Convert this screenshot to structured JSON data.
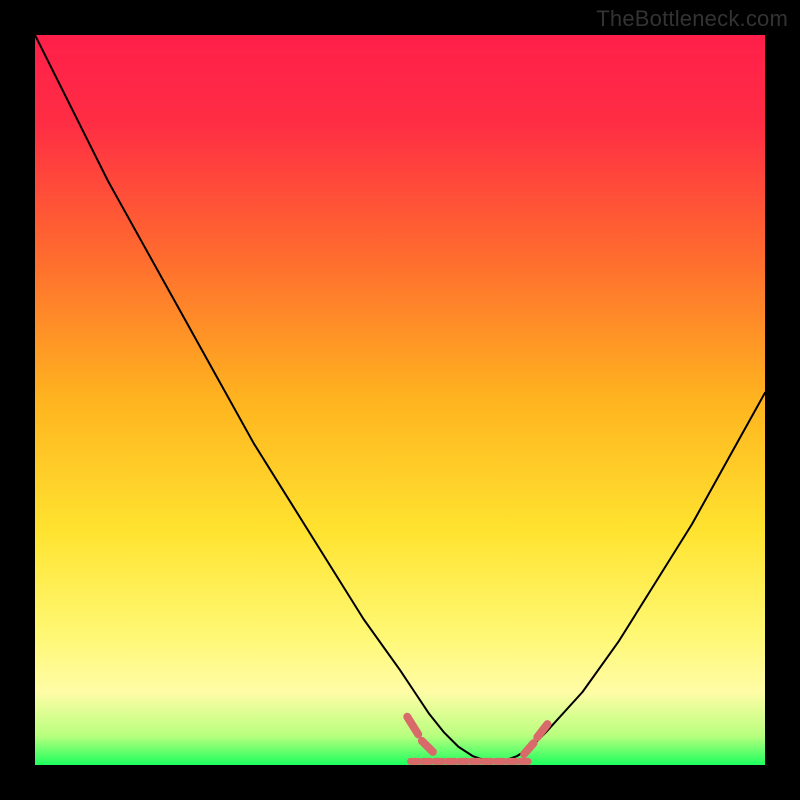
{
  "watermark": "TheBottleneck.com",
  "colors": {
    "black": "#000000",
    "red": "#ff1f4a",
    "yellow": "#ffe330",
    "pale_yellow": "#fffca6",
    "green": "#1dff5e",
    "curve": "#000000",
    "dots": "#d86a6a"
  },
  "chart_data": {
    "type": "line",
    "title": "",
    "xlabel": "",
    "ylabel": "",
    "xlim": [
      0,
      100
    ],
    "ylim": [
      0,
      100
    ],
    "x": [
      0,
      5,
      10,
      15,
      20,
      25,
      30,
      35,
      40,
      45,
      50,
      52,
      54,
      56,
      58,
      60,
      62,
      64,
      66,
      68,
      70,
      75,
      80,
      85,
      90,
      95,
      100
    ],
    "values": [
      100,
      90,
      80,
      71,
      62,
      53,
      44,
      36,
      28,
      20,
      13,
      10,
      7,
      4.5,
      2.5,
      1.2,
      0.5,
      0.5,
      1.2,
      2.5,
      4.5,
      10,
      17,
      25,
      33,
      42,
      51
    ],
    "flat_region": {
      "x_start": 52,
      "x_end": 67,
      "y": 0.5,
      "num_dots_bottom": 10
    },
    "gradient_stops": [
      {
        "offset": 0.0,
        "color": "#ff1f4a"
      },
      {
        "offset": 0.12,
        "color": "#ff2d44"
      },
      {
        "offset": 0.3,
        "color": "#ff6a2f"
      },
      {
        "offset": 0.5,
        "color": "#ffb41f"
      },
      {
        "offset": 0.68,
        "color": "#ffe330"
      },
      {
        "offset": 0.82,
        "color": "#fff873"
      },
      {
        "offset": 0.9,
        "color": "#fffca6"
      },
      {
        "offset": 0.96,
        "color": "#b8ff7e"
      },
      {
        "offset": 1.0,
        "color": "#1dff5e"
      }
    ]
  }
}
